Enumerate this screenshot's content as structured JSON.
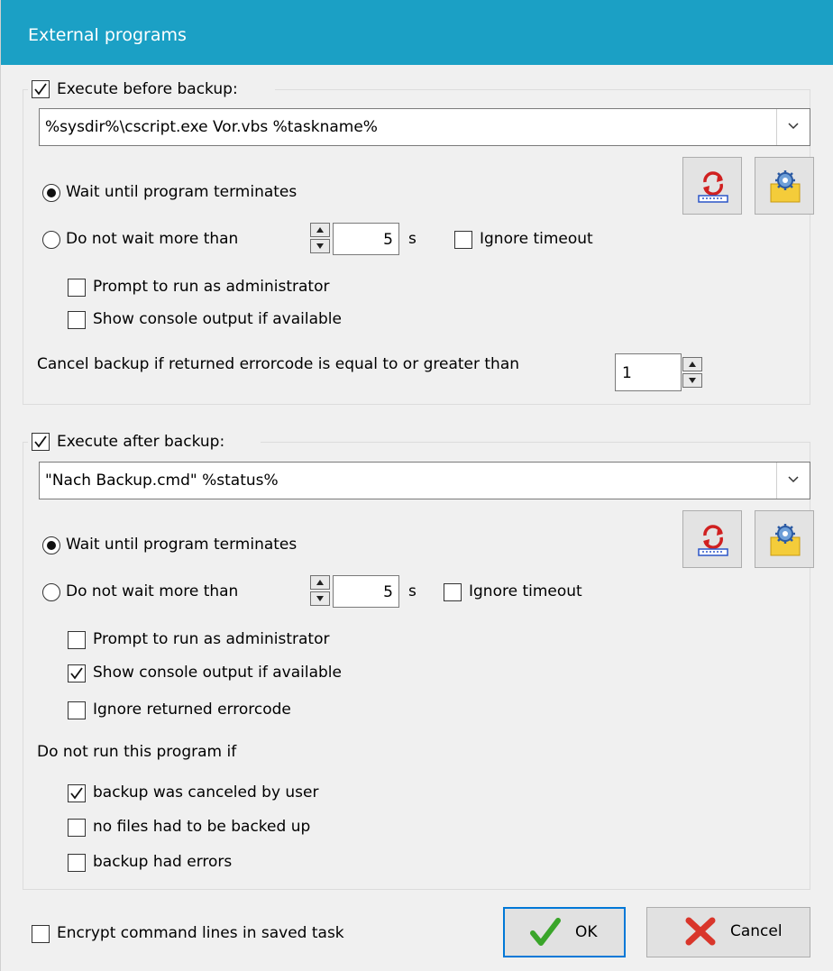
{
  "window": {
    "title": "External programs"
  },
  "before": {
    "checkbox_label": "Execute before backup:",
    "checked": true,
    "command": "%sysdir%\\cscript.exe Vor.vbs %taskname%",
    "wait_label": "Wait until program terminates",
    "no_wait_label": "Do not wait more than",
    "timeout_value": "5",
    "timeout_unit": "s",
    "ignore_timeout_label": "Ignore timeout",
    "prompt_admin_label": "Prompt to run as administrator",
    "console_label": "Show console output if available",
    "cancel_label": "Cancel backup if returned errorcode is equal to or greater than",
    "errorcode_value": "1"
  },
  "after": {
    "checkbox_label": "Execute after backup:",
    "checked": true,
    "command": "\"Nach Backup.cmd\" %status%",
    "wait_label": "Wait until program terminates",
    "no_wait_label": "Do not wait more than",
    "timeout_value": "5",
    "timeout_unit": "s",
    "ignore_timeout_label": "Ignore timeout",
    "prompt_admin_label": "Prompt to run as administrator",
    "console_label": "Show console output if available",
    "ignore_errorcode_label": "Ignore returned errorcode",
    "do_not_run_label": "Do not run this program if",
    "canceled_label": "backup was canceled by user",
    "no_files_label": "no files had to be backed up",
    "had_errors_label": "backup had errors"
  },
  "footer": {
    "encrypt_label": "Encrypt command lines in saved task",
    "ok_label": "OK",
    "cancel_label": "Cancel"
  },
  "colors": {
    "titlebar": "#1ba0c5",
    "accent": "#0078d7"
  },
  "icons": {
    "test_run": "test-run-icon",
    "settings": "settings-gear-icon",
    "ok": "checkmark-icon",
    "cancel": "red-x-icon"
  }
}
